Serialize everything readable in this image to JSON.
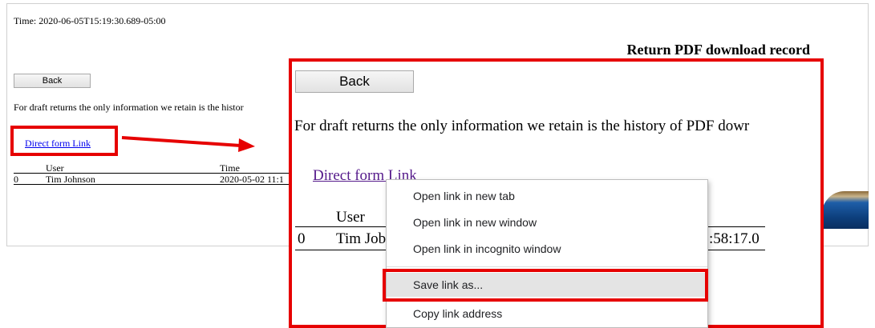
{
  "page": {
    "time_text": "Time: 2020-06-05T15:19:30.689-05:00",
    "title": "Return PDF download record",
    "back_label": "Back",
    "info_text": "For draft returns the only information we retain is the histor",
    "link_text": "Direct form Link",
    "table": {
      "headers": [
        "",
        "User",
        "Time"
      ],
      "rows": [
        {
          "index": "0",
          "user": "Tim Johnson",
          "time": "2020-05-02 11:1"
        }
      ]
    }
  },
  "zoom": {
    "back_label": "Back",
    "info_text": "For draft returns the only information we retain is the history of PDF dowr",
    "link_text": "Direct form Link",
    "header_user": "User",
    "row_index": "0",
    "row_user": "Tim Job",
    "row_time": ":58:17.0"
  },
  "context_menu": {
    "items": [
      "Open link in new tab",
      "Open link in new window",
      "Open link in incognito window",
      "Save link as...",
      "Copy link address"
    ],
    "highlighted": "Save link as..."
  },
  "colors": {
    "annotation_red": "#e60000",
    "link_blue": "#0000ee",
    "link_visited": "#551a8b",
    "menu_highlight": "#e4e4e4"
  }
}
